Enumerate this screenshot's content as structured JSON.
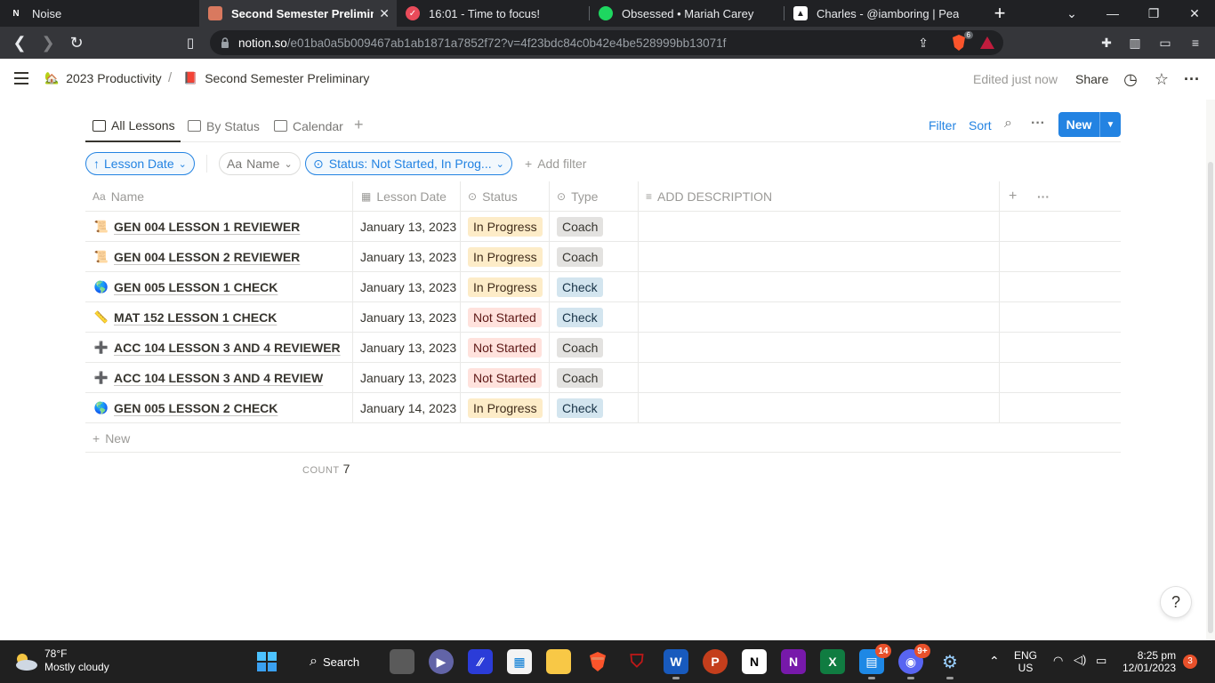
{
  "browser": {
    "tabs": [
      {
        "title": "Noise",
        "favicon": "notion-icon",
        "active": false
      },
      {
        "title": "Second Semester Preliminary",
        "favicon": "notebook-icon",
        "active": true
      },
      {
        "title": "16:01 - Time to focus!",
        "favicon": "check-icon",
        "active": false
      },
      {
        "title": "Obsessed • Mariah Carey",
        "favicon": "spotify-icon",
        "active": false
      },
      {
        "title": "Charles - @iamboring | PeakD",
        "favicon": "peakd-icon",
        "active": false
      }
    ],
    "url_host": "notion.so",
    "url_rest": "/e01ba0a5b009467ab1ab1871a7852f72?v=4f23bdc84c0b42e4be528999bb13071f",
    "brave_badge": "6"
  },
  "notion": {
    "breadcrumb": [
      {
        "label": "2023 Productivity",
        "icon": "house-icon"
      },
      {
        "label": "Second Semester Preliminary",
        "icon": "notebook-icon"
      }
    ],
    "edited": "Edited just now",
    "share": "Share"
  },
  "views": {
    "tabs": [
      "All Lessons",
      "By Status",
      "Calendar"
    ],
    "filter": "Filter",
    "sort": "Sort",
    "new": "New"
  },
  "filters": {
    "sort_chip": "Lesson Date",
    "name_chip": "Name",
    "name_prefix": "Aa",
    "status_chip": "Status: Not Started, In Prog...",
    "add_filter": "Add filter"
  },
  "table": {
    "columns": [
      "Name",
      "Lesson Date",
      "Status",
      "Type",
      "ADD DESCRIPTION"
    ],
    "rows": [
      {
        "icon": "📜",
        "name": "GEN 004 LESSON 1 REVIEWER",
        "date": "January 13, 2023",
        "status": "In Progress",
        "type": "Coach"
      },
      {
        "icon": "📜",
        "name": "GEN 004 LESSON 2 REVIEWER",
        "date": "January 13, 2023",
        "status": "In Progress",
        "type": "Coach"
      },
      {
        "icon": "🌎",
        "name": "GEN 005 LESSON 1 CHECK",
        "date": "January 13, 2023",
        "status": "In Progress",
        "type": "Check"
      },
      {
        "icon": "📏",
        "name": "MAT 152 LESSON 1 CHECK",
        "date": "January 13, 2023",
        "status": "Not Started",
        "type": "Check"
      },
      {
        "icon": "➕",
        "name": "ACC 104 LESSON 3 AND 4 REVIEWER",
        "date": "January 13, 2023",
        "status": "Not Started",
        "type": "Coach"
      },
      {
        "icon": "➕",
        "name": "ACC 104 LESSON 3 AND 4 REVIEW",
        "date": "January 13, 2023",
        "status": "Not Started",
        "type": "Coach"
      },
      {
        "icon": "🌎",
        "name": "GEN 005 LESSON 2 CHECK",
        "date": "January 14, 2023",
        "status": "In Progress",
        "type": "Check"
      }
    ],
    "new_row": "New",
    "count_label": "COUNT",
    "count_value": "7"
  },
  "colors": {
    "in_progress_bg": "#fdecc8",
    "in_progress_fg": "#402c1b",
    "not_started_bg": "#ffe2dd",
    "not_started_fg": "#5d1715",
    "coach_bg": "#e3e2e0",
    "check_bg": "#d3e5ef",
    "check_fg": "#183347",
    "accent": "#2383e2"
  },
  "help": "?",
  "taskbar": {
    "temp": "78°F",
    "weather": "Mostly cloudy",
    "search": "Search",
    "lang1": "ENG",
    "lang2": "US",
    "time": "8:25 pm",
    "date": "12/01/2023",
    "notif": "3",
    "badge_teams": "14",
    "badge_discord": "9+"
  }
}
